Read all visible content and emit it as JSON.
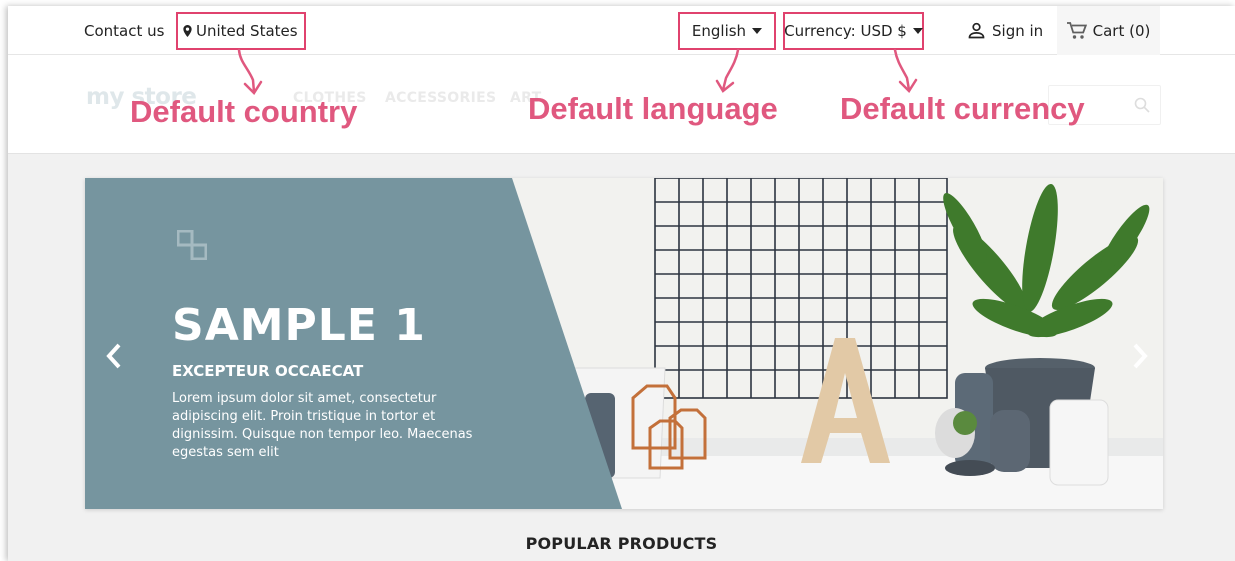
{
  "topnav": {
    "contact": "Contact us",
    "country": "United States",
    "language": "English",
    "currency": "Currency: USD $",
    "signin": "Sign in",
    "cart": "Cart (0)"
  },
  "header": {
    "logo": "my store",
    "menu": [
      "CLOTHES",
      "ACCESSORIES",
      "ART"
    ]
  },
  "annotations": {
    "country": "Default country",
    "language": "Default language",
    "currency": "Default currency",
    "color": "#e0587f"
  },
  "slider": {
    "title": "SAMPLE 1",
    "subtitle": "EXCEPTEUR OCCAECAT",
    "text": "Lorem ipsum dolor sit amet, consectetur adipiscing elit. Proin tristique in tortor et dignissim. Quisque non tempor leo. Maecenas egestas sem elit",
    "panel_color": "#76959f"
  },
  "section": {
    "popular": "POPULAR PRODUCTS"
  },
  "colors": {
    "highlight": "#e0426e",
    "accent": "#e0587f"
  }
}
